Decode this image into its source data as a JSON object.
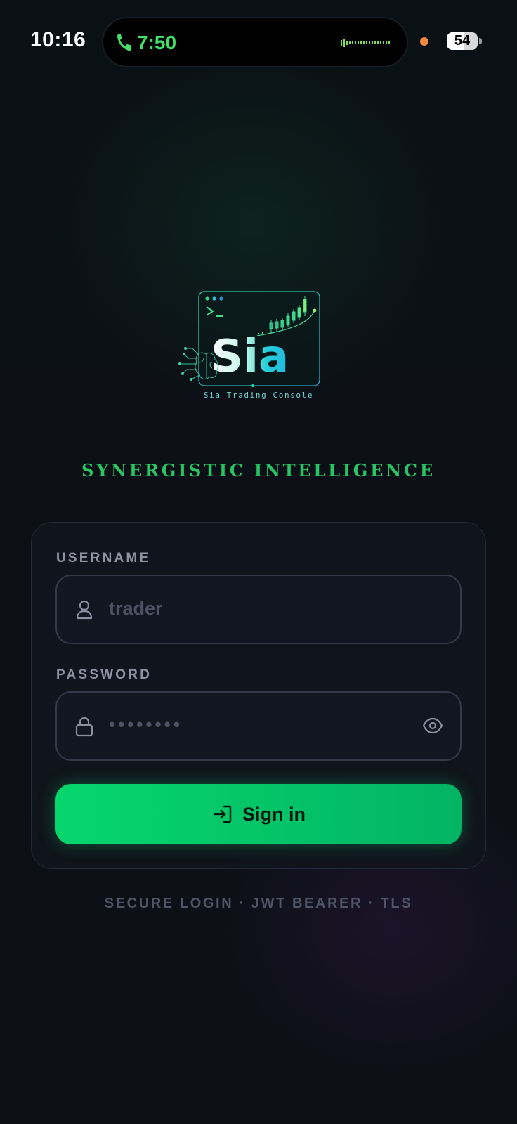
{
  "status_bar": {
    "time": "10:16",
    "call_timer": "7:50",
    "battery_level": "54",
    "battery_fraction": 0.54
  },
  "brand": {
    "logo_text": "Sia",
    "logo_caption": "Sia Trading Console",
    "tagline": "SYNERGISTIC INTELLIGENCE"
  },
  "login": {
    "username_label": "USERNAME",
    "username_placeholder": "trader",
    "password_label": "PASSWORD",
    "password_mask": "••••••••",
    "signin_label": "Sign in"
  },
  "footer": {
    "note": "SECURE LOGIN · JWT BEARER · TLS"
  },
  "icons": {
    "call": "phone-icon",
    "user": "user-icon",
    "lock": "lock-icon",
    "eye": "eye-icon",
    "signin": "sign-in-arrow-icon"
  },
  "colors": {
    "accent_green": "#06d66d",
    "tagline_green": "#29c463",
    "call_green": "#43e06a",
    "mic_indicator": "#f0883e",
    "background": "#0b0e14"
  }
}
